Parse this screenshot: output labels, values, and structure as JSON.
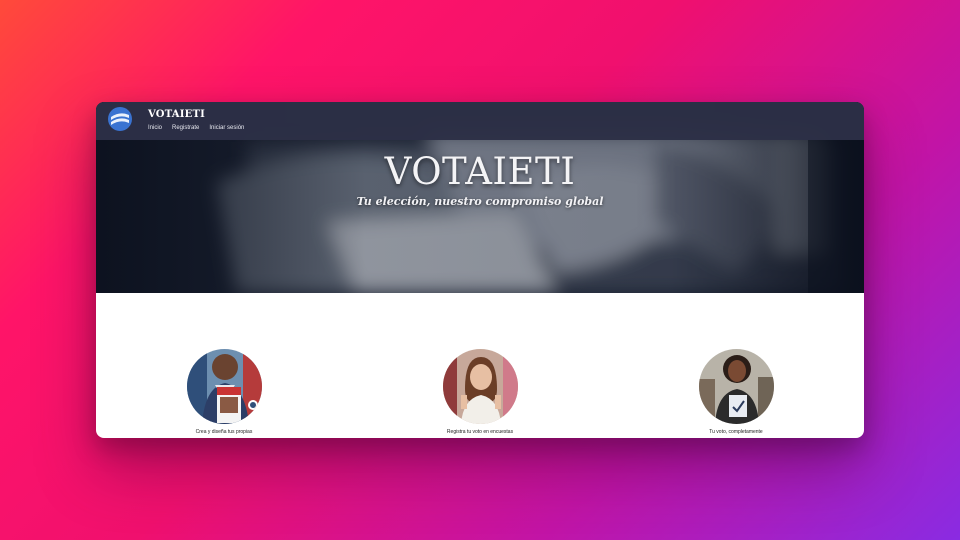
{
  "app": {
    "brand": "VOTAIETI",
    "nav": [
      "Inicio",
      "Registrate",
      "Iniciar sesión"
    ]
  },
  "hero": {
    "title": "VOTAIETI",
    "subtitle": "Tu elección, nuestro compromiso global"
  },
  "features": [
    {
      "caption": "Crea y diseña tus propias",
      "icon": "man-holding-ballot-photo"
    },
    {
      "caption": "Registra tu voto en encuestas",
      "icon": "woman-smiling-photo"
    },
    {
      "caption": "Tu voto, completamente",
      "icon": "woman-with-ballot-photo"
    }
  ],
  "colors": {
    "navbar": "#2c3046",
    "logo": "#3a73d1",
    "background_gradient": [
      "#ff4a3a",
      "#f0106e",
      "#8a2be2"
    ]
  }
}
